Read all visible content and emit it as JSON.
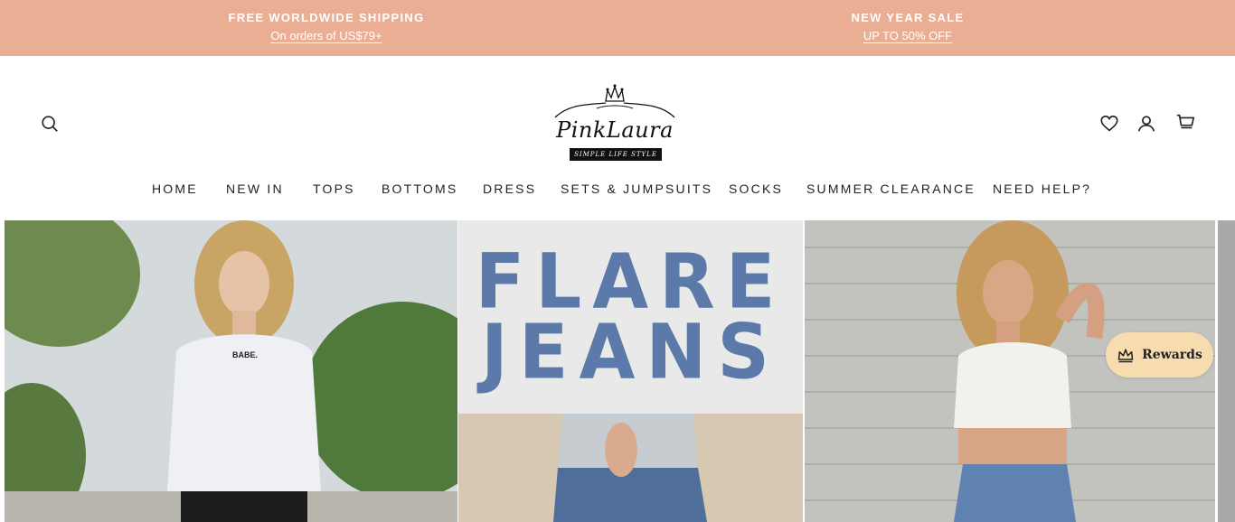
{
  "announcement": {
    "left": {
      "title": "FREE WORLDWIDE SHIPPING",
      "link": "On orders of US$79+"
    },
    "right": {
      "title": "NEW YEAR SALE",
      "link": "UP TO 50% OFF"
    },
    "background": "#eaae95"
  },
  "header": {
    "logo": {
      "name": "PinkLaura",
      "tagline": "SIMPLE LIFE STYLE"
    },
    "icons": {
      "search": "search-icon",
      "wishlist": "heart-icon",
      "account": "user-icon",
      "cart": "cart-icon"
    }
  },
  "nav": {
    "items": [
      {
        "label": "HOME"
      },
      {
        "label": "NEW IN"
      },
      {
        "label": "TOPS"
      },
      {
        "label": "BOTTOMS"
      },
      {
        "label": "DRESS"
      },
      {
        "label": "SETS & JUMPSUITS"
      },
      {
        "label": "SOCKS"
      },
      {
        "label": "SUMMER CLEARANCE"
      },
      {
        "label": "NEED HELP?"
      }
    ]
  },
  "hero": {
    "panel_2": {
      "line_1": "FLARE",
      "line_2": "JEANS",
      "text_color": "#5b7aa9"
    },
    "panel_1_print": "BABE."
  },
  "rewards": {
    "label": "Rewards",
    "icon": "crown-icon",
    "background": "#f6dcae"
  }
}
